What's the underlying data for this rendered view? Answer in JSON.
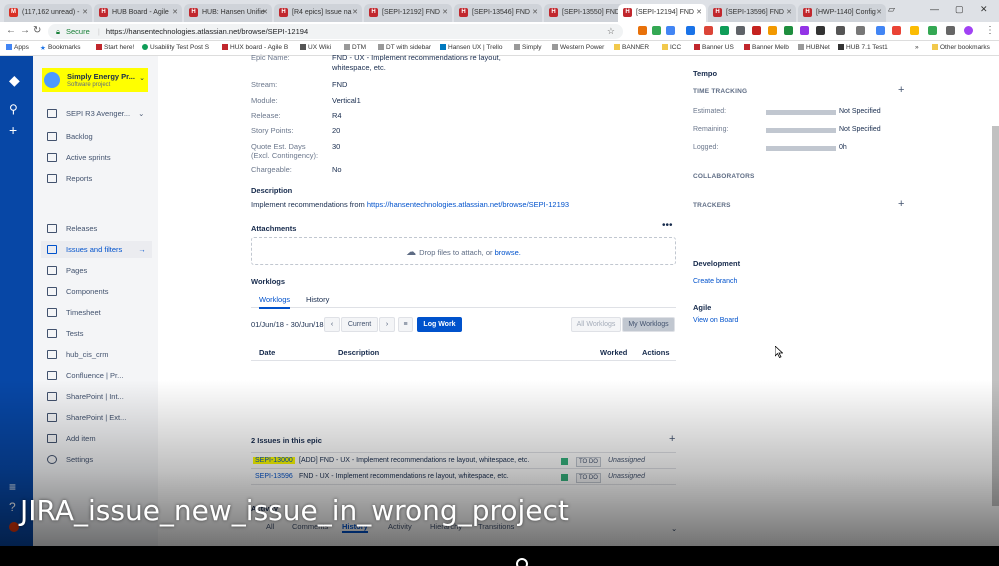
{
  "browser": {
    "tabs": [
      {
        "label": "(117,162 unread) -",
        "favicon": "gmail-icon"
      },
      {
        "label": "HUB Board - Agile",
        "favicon": "jira-icon"
      },
      {
        "label": "HUB: Hansen Unifie",
        "favicon": "jira-icon"
      },
      {
        "label": "[R4 epics] Issue na",
        "favicon": "jira-icon"
      },
      {
        "label": "[SEPI-12192] FND",
        "favicon": "jira-icon"
      },
      {
        "label": "[SEPI-13546] FND",
        "favicon": "jira-icon"
      },
      {
        "label": "[SEPI-13550] FND",
        "favicon": "jira-icon"
      },
      {
        "label": "[SEPI-12194] FND",
        "favicon": "jira-icon",
        "active": true
      },
      {
        "label": "[SEPI-13596] FND",
        "favicon": "jira-icon"
      },
      {
        "label": "[HWP-1140] Config",
        "favicon": "jira-icon"
      }
    ],
    "secure_label": "Secure",
    "url": "https://hansentechnologies.atlassian.net/browse/SEPI-12194",
    "bookmarks": [
      "Apps",
      "Bookmarks",
      "Start here!",
      "Usability Test Post S",
      "HUX board - Agile B",
      "UX Wiki",
      "DTM",
      "DT with sidebar",
      "Hansen UX | Trello",
      "Simply",
      "Western Power",
      "BANNER",
      "ICC",
      "Banner US",
      "Banner Melb",
      "HUBNet",
      "HUB 7.1 Test1"
    ],
    "other_bookmarks": "Other bookmarks"
  },
  "project": {
    "name": "Simply Energy Pr...",
    "type": "Software project",
    "board": "SEPI R3 Avenger...",
    "nav": [
      {
        "label": "Backlog",
        "icon": "backlog-icon"
      },
      {
        "label": "Active sprints",
        "icon": "board-icon"
      },
      {
        "label": "Reports",
        "icon": "reports-icon"
      },
      {
        "label": "Releases",
        "icon": "ship-icon"
      },
      {
        "label": "Issues and filters",
        "icon": "issues-icon",
        "active": true
      },
      {
        "label": "Pages",
        "icon": "page-icon"
      },
      {
        "label": "Components",
        "icon": "component-icon"
      },
      {
        "label": "Timesheet",
        "icon": "calendar-icon"
      },
      {
        "label": "Tests",
        "icon": "test-icon"
      },
      {
        "label": "hub_cis_crm",
        "icon": "shortcut-icon"
      },
      {
        "label": "Confluence | Pr...",
        "icon": "shortcut-icon"
      },
      {
        "label": "SharePoint | Int...",
        "icon": "shortcut-icon"
      },
      {
        "label": "SharePoint | Ext...",
        "icon": "shortcut-icon"
      },
      {
        "label": "Add item",
        "icon": "add-icon"
      },
      {
        "label": "Settings",
        "icon": "gear-icon"
      }
    ]
  },
  "details": {
    "epic_name_label": "Epic Name:",
    "epic_name_value": "FND - UX - Implement recommendations re layout, whitespace, etc.",
    "fields": [
      {
        "label": "Stream:",
        "value": "FND"
      },
      {
        "label": "Module:",
        "value": "Vertical1"
      },
      {
        "label": "Release:",
        "value": "R4"
      },
      {
        "label": "Story Points:",
        "value": "20"
      },
      {
        "label": "Quote Est. Days (Excl. Contingency):",
        "value": "30"
      },
      {
        "label": "Chargeable:",
        "value": "No"
      }
    ],
    "description_heading": "Description",
    "description_text": "Implement recommendations from",
    "description_link": "https://hansentechnologies.atlassian.net/browse/SEPI-12193",
    "attachments_heading": "Attachments",
    "drop_text": "Drop files to attach, or",
    "browse_link": "browse."
  },
  "worklogs": {
    "heading": "Worklogs",
    "tabs": [
      "Worklogs",
      "History"
    ],
    "date_range": "01/Jun/18 - 30/Jun/18",
    "current_label": "Current",
    "log_work_label": "Log Work",
    "all_worklogs_label": "All Worklogs",
    "my_worklogs_label": "My Worklogs",
    "columns": [
      "Date",
      "Description",
      "Worked",
      "Actions"
    ]
  },
  "epic_issues": {
    "heading": "2 Issues in this epic",
    "rows": [
      {
        "key": "SEPI-13000",
        "summary": "[ADD] FND - UX - Implement recommendations re layout, whitespace, etc.",
        "status": "TO DO",
        "assignee": "Unassigned",
        "highlighted": true
      },
      {
        "key": "SEPI-13596",
        "summary": "FND - UX - Implement recommendations re layout, whitespace, etc.",
        "status": "TO DO",
        "assignee": "Unassigned"
      }
    ]
  },
  "activity": {
    "heading": "Activity",
    "tabs": [
      "All",
      "Comments",
      "History",
      "Activity",
      "Hierarchy",
      "Transitions"
    ]
  },
  "tempo": {
    "heading": "Tempo",
    "time_tracking_heading": "TIME TRACKING",
    "rows": [
      {
        "label": "Estimated:",
        "value": "Not Specified"
      },
      {
        "label": "Remaining:",
        "value": "Not Specified"
      },
      {
        "label": "Logged:",
        "value": "0h"
      }
    ],
    "collaborators_heading": "COLLABORATORS",
    "trackers_heading": "TRACKERS"
  },
  "development": {
    "heading": "Development",
    "create_branch": "Create branch"
  },
  "agile": {
    "heading": "Agile",
    "view_on_board": "View on Board"
  },
  "video_caption": "JIRA_issue_new_issue_in_wrong_project"
}
